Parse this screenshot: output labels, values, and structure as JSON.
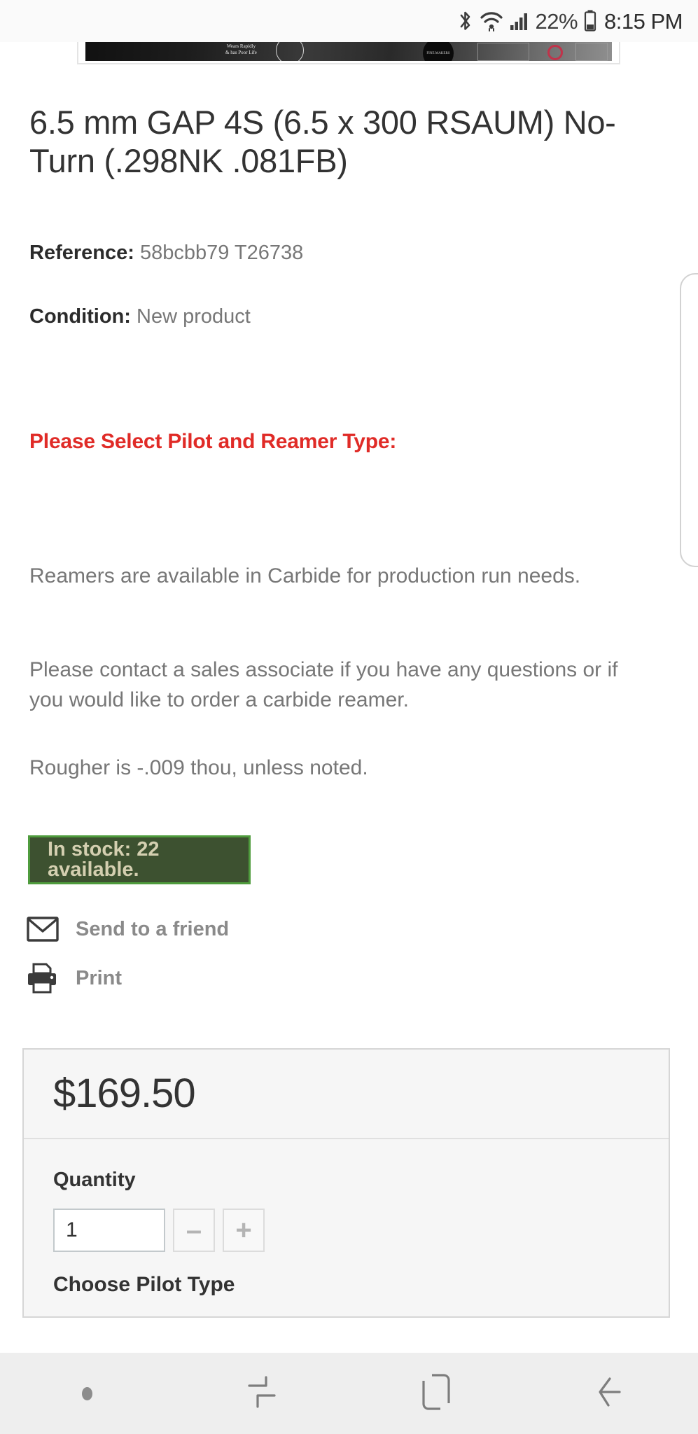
{
  "status_bar": {
    "battery_percent": "22%",
    "time": "8:15 PM",
    "icons": [
      "bluetooth-icon",
      "wifi-icon",
      "cellular-signal-icon",
      "battery-icon"
    ]
  },
  "banner": {
    "caption_line1": "Wears Rapidly",
    "caption_line2": "& has Poor Life",
    "seal_text": "FINE MAKERS"
  },
  "product": {
    "title": "6.5 mm GAP 4S (6.5 x 300 RSAUM) No-Turn (.298NK .081FB)",
    "reference_label": "Reference:",
    "reference_value": "58bcbb79 T26738",
    "condition_label": "Condition:",
    "condition_value": "New product",
    "select_note": "Please Select Pilot and Reamer Type:",
    "paragraphs": [
      "Reamers are available in Carbide for production run needs.",
      "Please contact a sales associate if you have any questions or if you would like to order a carbide reamer.",
      "Rougher is -.009 thou, unless noted."
    ],
    "stock_status": "In stock: 22 available.",
    "stock_color": "#3d5130",
    "stock_border_color": "#4f9c3d",
    "stock_text_color": "#d4cfb0",
    "accent_red": "#e02b27"
  },
  "actions": [
    {
      "label": "Send to a friend",
      "icon": "envelope-icon"
    },
    {
      "label": "Print",
      "icon": "printer-icon"
    }
  ],
  "purchase": {
    "price": "$169.50",
    "quantity_label": "Quantity",
    "quantity_value": "1",
    "decrease_label": "–",
    "increase_label": "+",
    "choose_pilot_label": "Choose Pilot Type"
  },
  "nav_bar": {
    "items": [
      "menu-dot-icon",
      "recents-icon",
      "home-icon",
      "back-icon"
    ]
  }
}
